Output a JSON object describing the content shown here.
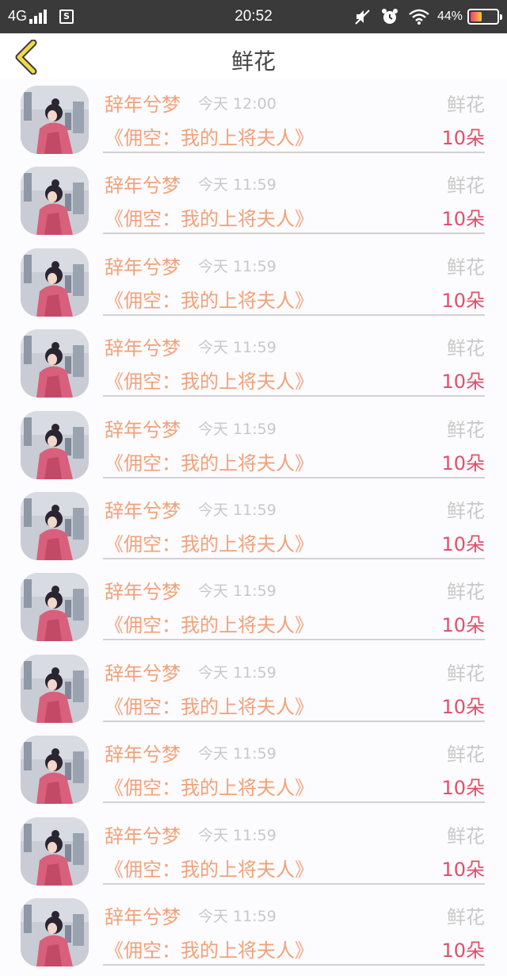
{
  "status_bar": {
    "network": "4G",
    "time": "20:52",
    "battery_percent": "44%",
    "battery_level": 0.44,
    "icons": [
      "signal-icon",
      "sim-icon",
      "mute-icon",
      "alarm-icon",
      "wifi-icon",
      "battery-icon"
    ]
  },
  "nav": {
    "back_icon": "chevron-left-icon",
    "title": "鲜花"
  },
  "colors": {
    "sender": "#f0a27a",
    "time": "#c8c8c8",
    "count": "#e0506b",
    "divider": "#d2d2d2",
    "back_icon": "#f3d84a"
  },
  "records": [
    {
      "sender": "辞年兮梦",
      "time": "今天 12:00",
      "type": "鲜花",
      "book": "《佣空：我的上将夫人》",
      "count": "10朵"
    },
    {
      "sender": "辞年兮梦",
      "time": "今天 11:59",
      "type": "鲜花",
      "book": "《佣空：我的上将夫人》",
      "count": "10朵"
    },
    {
      "sender": "辞年兮梦",
      "time": "今天 11:59",
      "type": "鲜花",
      "book": "《佣空：我的上将夫人》",
      "count": "10朵"
    },
    {
      "sender": "辞年兮梦",
      "time": "今天 11:59",
      "type": "鲜花",
      "book": "《佣空：我的上将夫人》",
      "count": "10朵"
    },
    {
      "sender": "辞年兮梦",
      "time": "今天 11:59",
      "type": "鲜花",
      "book": "《佣空：我的上将夫人》",
      "count": "10朵"
    },
    {
      "sender": "辞年兮梦",
      "time": "今天 11:59",
      "type": "鲜花",
      "book": "《佣空：我的上将夫人》",
      "count": "10朵"
    },
    {
      "sender": "辞年兮梦",
      "time": "今天 11:59",
      "type": "鲜花",
      "book": "《佣空：我的上将夫人》",
      "count": "10朵"
    },
    {
      "sender": "辞年兮梦",
      "time": "今天 11:59",
      "type": "鲜花",
      "book": "《佣空：我的上将夫人》",
      "count": "10朵"
    },
    {
      "sender": "辞年兮梦",
      "time": "今天 11:59",
      "type": "鲜花",
      "book": "《佣空：我的上将夫人》",
      "count": "10朵"
    },
    {
      "sender": "辞年兮梦",
      "time": "今天 11:59",
      "type": "鲜花",
      "book": "《佣空：我的上将夫人》",
      "count": "10朵"
    },
    {
      "sender": "辞年兮梦",
      "time": "今天 11:59",
      "type": "鲜花",
      "book": "《佣空：我的上将夫人》",
      "count": "10朵"
    }
  ]
}
